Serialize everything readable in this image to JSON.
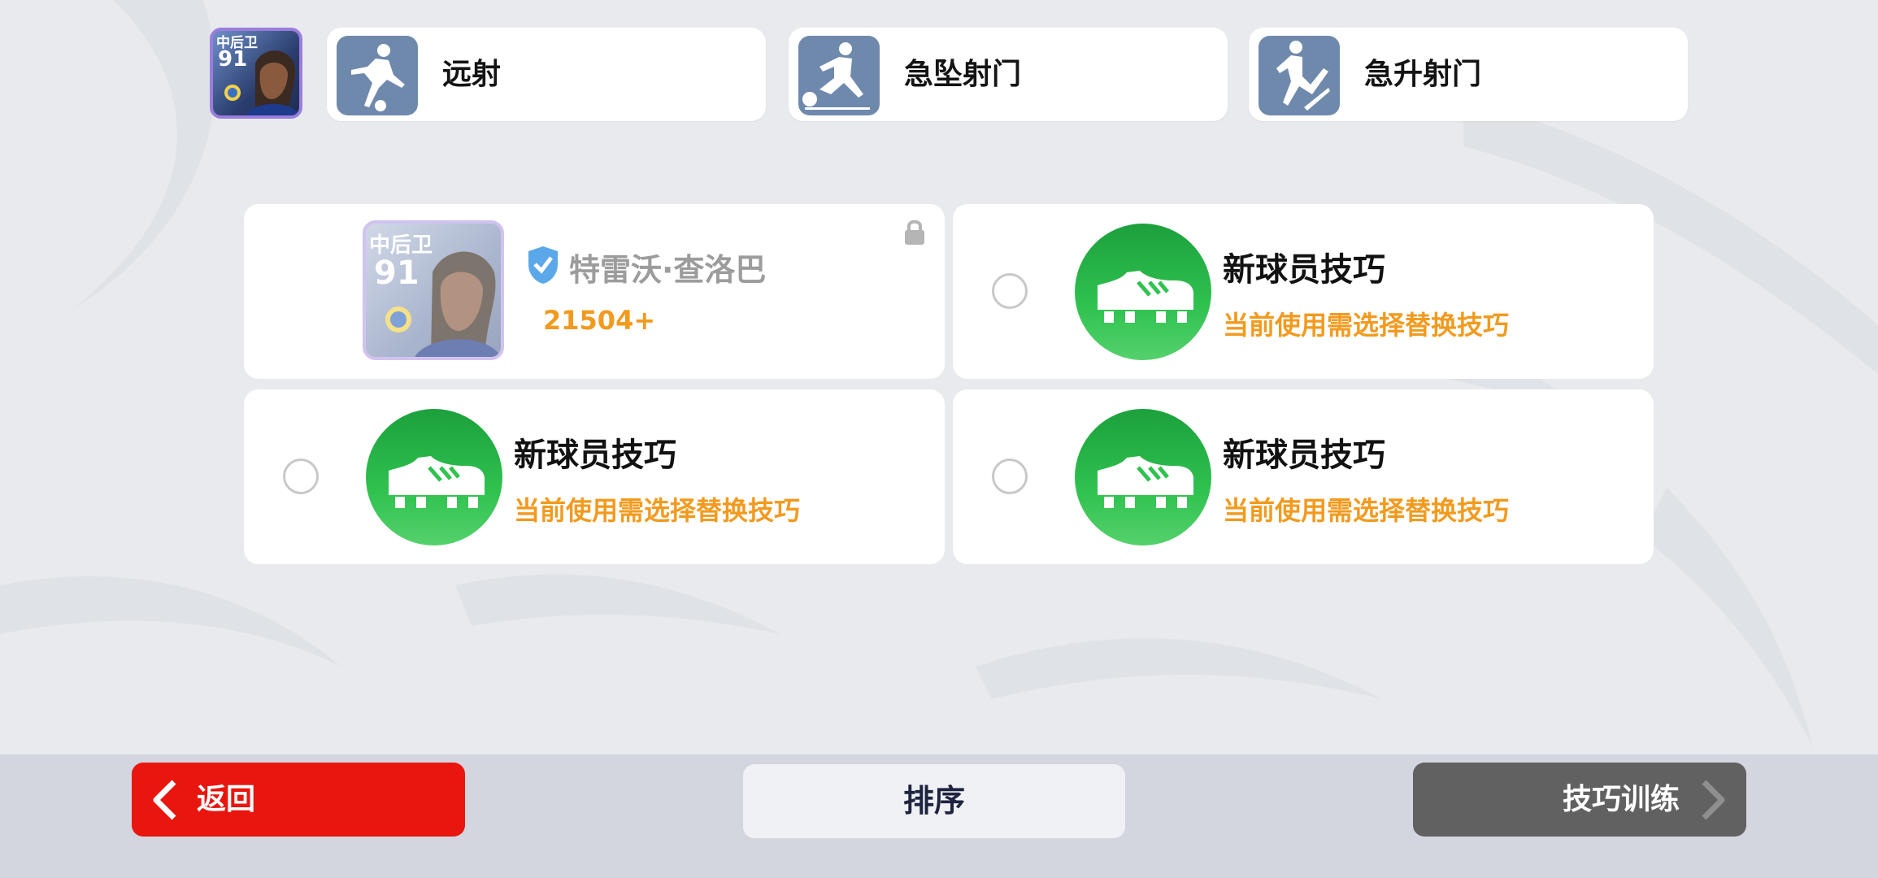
{
  "top_bar": {
    "slots": [
      {
        "label": "远射",
        "icon": "long-shot-icon"
      },
      {
        "label": "急坠射门",
        "icon": "dipping-shot-icon"
      },
      {
        "label": "急升射门",
        "icon": "rising-shot-icon"
      }
    ],
    "avatar": {
      "position": "中后卫",
      "rating": "91"
    }
  },
  "player_card": {
    "position": "中后卫",
    "rating": "91",
    "name": "特雷沃·查洛巴",
    "score": "21504+",
    "locked": true
  },
  "skill_cards": [
    {
      "title": "新球员技巧",
      "subtitle": "当前使用需选择替换技巧",
      "selected": false
    },
    {
      "title": "新球员技巧",
      "subtitle": "当前使用需选择替换技巧",
      "selected": false
    },
    {
      "title": "新球员技巧",
      "subtitle": "当前使用需选择替换技巧",
      "selected": false
    }
  ],
  "bottom_bar": {
    "back_label": "返回",
    "sort_label": "排序",
    "training_label": "技巧训练"
  },
  "colors": {
    "back_button": "#e8160f",
    "training_button": "#616161",
    "subtitle_orange": "#f29a1e",
    "skill_green": "#2fc24f",
    "slot_icon_blue": "#6f89ad"
  }
}
